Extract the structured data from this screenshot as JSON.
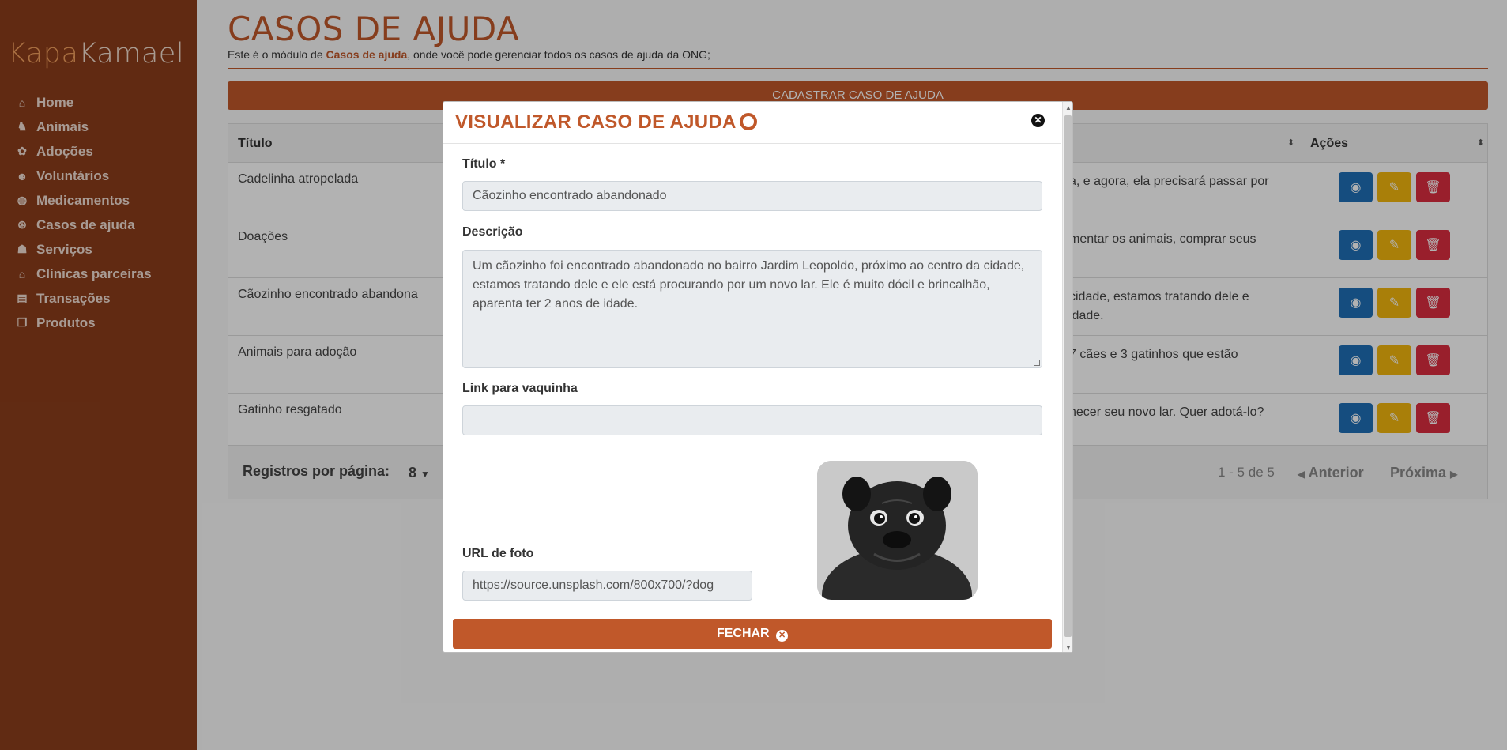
{
  "app": {
    "logo_part1": "Kapa",
    "logo_part2": "Kamael"
  },
  "sidebar": {
    "items": [
      {
        "label": "Home",
        "icon": "home-icon"
      },
      {
        "label": "Animais",
        "icon": "dog-icon"
      },
      {
        "label": "Adoções",
        "icon": "paw-icon"
      },
      {
        "label": "Voluntários",
        "icon": "people-icon"
      },
      {
        "label": "Medicamentos",
        "icon": "pills-icon"
      },
      {
        "label": "Casos de ajuda",
        "icon": "lifebuoy-icon"
      },
      {
        "label": "Serviços",
        "icon": "hand-holding-icon"
      },
      {
        "label": "Clínicas parceiras",
        "icon": "clinic-icon"
      },
      {
        "label": "Transações",
        "icon": "money-icon"
      },
      {
        "label": "Produtos",
        "icon": "boxes-icon"
      }
    ]
  },
  "page": {
    "title": "CASOS DE AJUDA",
    "subtitle_prefix": "Este é o módulo de ",
    "subtitle_bold": "Casos de ajuda",
    "subtitle_suffix": ", onde você pode gerenciar todos os casos de ajuda da ONG;",
    "add_button": "CADASTRAR CASO DE AJUDA"
  },
  "table": {
    "col_title": "Título",
    "col_actions": "Ações",
    "rows": [
      {
        "title": "Cadelinha atropelada",
        "desc": "a, e agora, ela precisará passar por"
      },
      {
        "title": "Doações",
        "desc": "mentar os animais, comprar seus"
      },
      {
        "title": "Cãozinho encontrado abandona",
        "desc": "cidade, estamos tratando dele e\nidade."
      },
      {
        "title": "Animais para adoção",
        "desc": "7 cães e 3 gatinhos que estão"
      },
      {
        "title": "Gatinho resgatado",
        "desc": "hecer seu novo lar. Quer adotá-lo?"
      }
    ],
    "footer": {
      "rows_per_page_label": "Registros por página:",
      "rows_per_page_value": "8",
      "count": "1 - 5 de 5",
      "prev": "Anterior",
      "next": "Próxima"
    }
  },
  "modal": {
    "title": "VISUALIZAR CASO DE AJUDA",
    "titulo_label": "Título *",
    "titulo_value": "Cãozinho encontrado abandonado",
    "descricao_label": "Descrição",
    "descricao_value": "Um cãozinho foi encontrado abandonado no bairro Jardim Leopoldo, próximo ao centro da cidade, estamos tratando dele e ele está procurando por um novo lar. Ele é muito dócil e brincalhão, aparenta ter 2 anos de idade.",
    "link_label": "Link para vaquinha",
    "link_value": "",
    "url_label": "URL de foto",
    "url_value": "https://source.unsplash.com/800x700/?dog",
    "close_button": "FECHAR"
  },
  "colors": {
    "sidebar": "#8b3d1b",
    "accent": "#c0582a",
    "view": "#1f6fb6",
    "edit": "#f2b60d",
    "delete": "#dc2d3f"
  }
}
